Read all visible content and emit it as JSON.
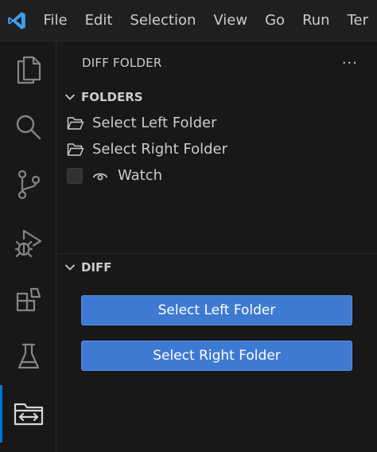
{
  "menu": [
    "File",
    "Edit",
    "Selection",
    "View",
    "Go",
    "Run",
    "Ter"
  ],
  "activity_bar": {
    "icons": [
      "explorer-icon",
      "search-icon",
      "source-control-icon",
      "run-debug-icon",
      "extensions-icon",
      "testing-icon",
      "diff-folder-icon"
    ],
    "active": "diff-folder-icon"
  },
  "sidebar": {
    "title": "DIFF FOLDER",
    "more": "···",
    "folders_section": {
      "title": "FOLDERS",
      "items": [
        {
          "label": "Select Left Folder",
          "icon": "folder-icon"
        },
        {
          "label": "Select Right Folder",
          "icon": "folder-icon"
        },
        {
          "label": "Watch",
          "icon": "eye-icon",
          "checked": false
        }
      ]
    },
    "diff_section": {
      "title": "DIFF",
      "buttons": [
        "Select Left Folder",
        "Select Right Folder"
      ]
    }
  },
  "colors": {
    "accent": "#0078d4",
    "button": "#3f7ad2",
    "background": "#181818"
  }
}
